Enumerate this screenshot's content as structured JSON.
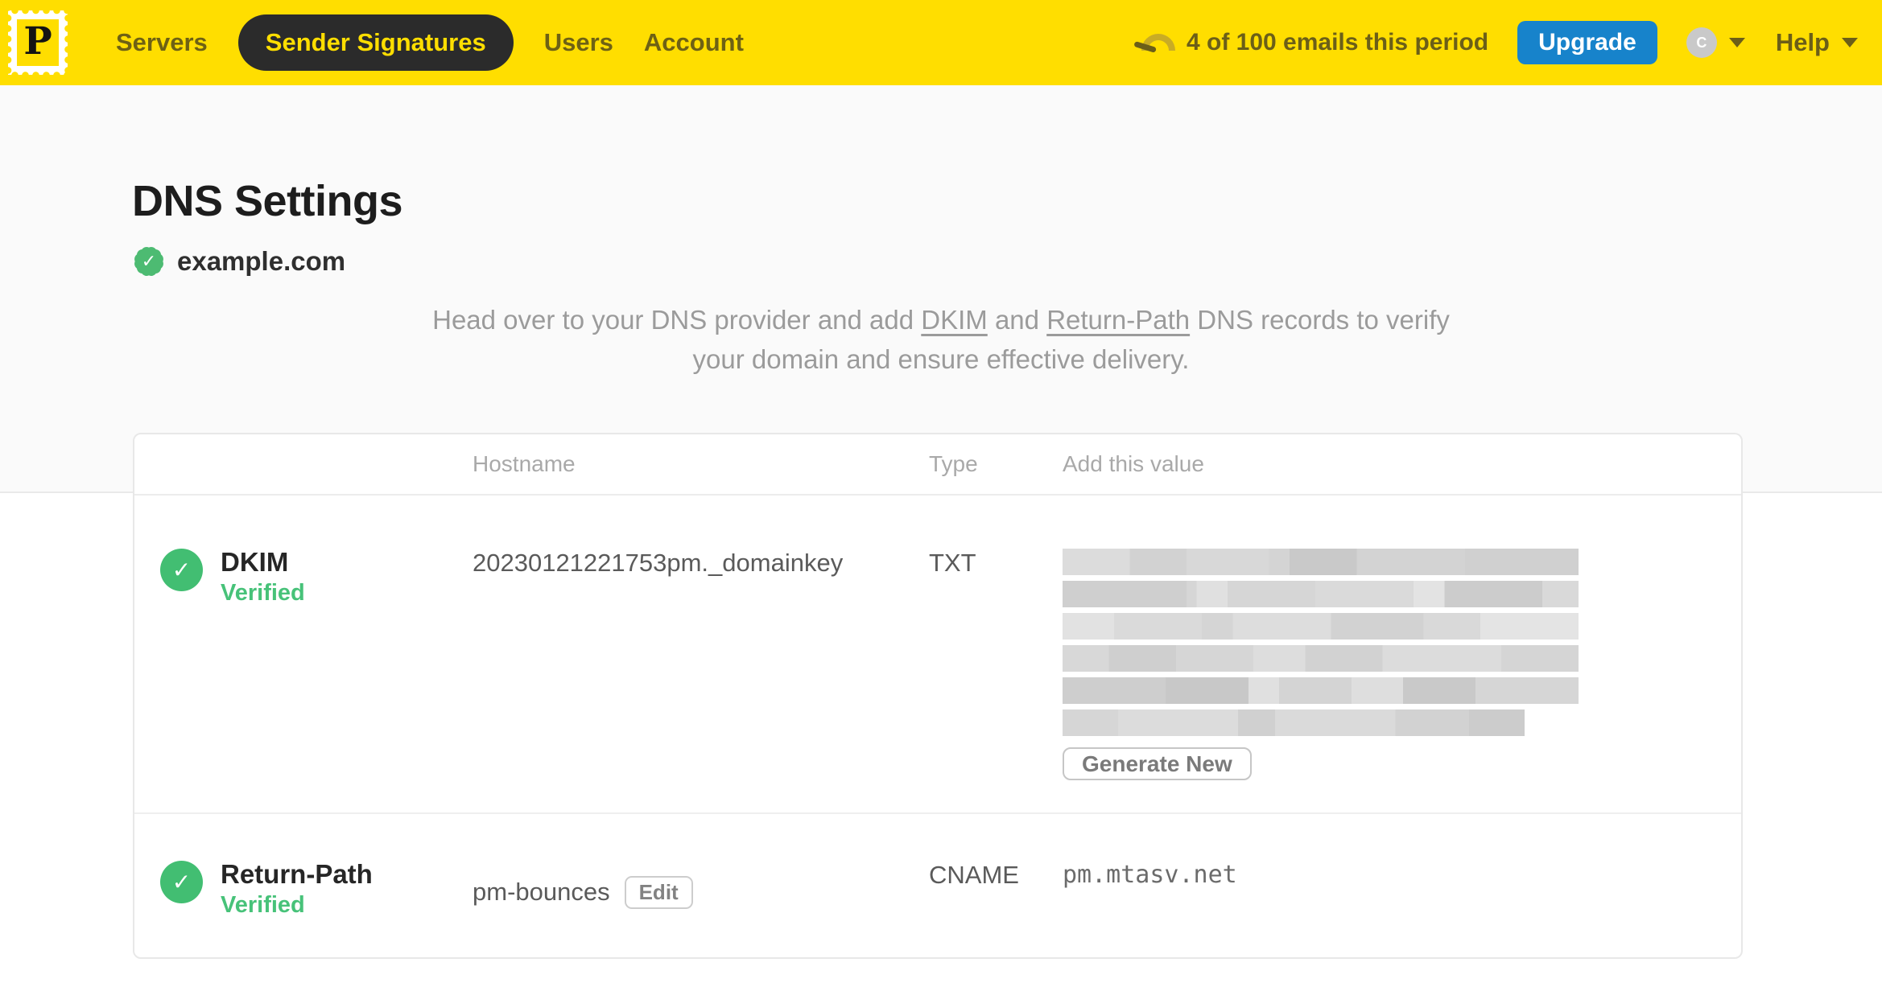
{
  "topbar": {
    "logo_letter": "P",
    "nav_items": [
      {
        "label": "Servers",
        "active": false
      },
      {
        "label": "Sender Signatures",
        "active": true
      },
      {
        "label": "Users",
        "active": false
      },
      {
        "label": "Account",
        "active": false
      }
    ],
    "usage_text": "4 of 100 emails this period",
    "upgrade_label": "Upgrade",
    "avatar_initial": "C",
    "help_label": "Help"
  },
  "page": {
    "title": "DNS Settings",
    "domain": "example.com",
    "description": {
      "pre": "Head over to your DNS provider and add ",
      "link_dkim": "DKIM",
      "mid": " and ",
      "link_return_path": "Return-Path",
      "post": " DNS records to verify your domain and ensure effective delivery."
    }
  },
  "dns_table": {
    "headers": {
      "hostname": "Hostname",
      "type": "Type",
      "value": "Add this value"
    },
    "rows": [
      {
        "name": "DKIM",
        "status": "Verified",
        "hostname": "20230121221753pm._domainkey",
        "type": "TXT",
        "value_display": "redacted",
        "action_label": "Generate New"
      },
      {
        "name": "Return-Path",
        "status": "Verified",
        "hostname": "pm-bounces",
        "edit_label": "Edit",
        "type": "CNAME",
        "value": "pm.mtasv.net"
      }
    ]
  },
  "colors": {
    "brand_yellow": "#FFDE00",
    "nav_pill_dark": "#2B2B2B",
    "upgrade_blue": "#1783CB",
    "verified_green": "#42BE72",
    "description_gray": "#9B9B9B"
  }
}
